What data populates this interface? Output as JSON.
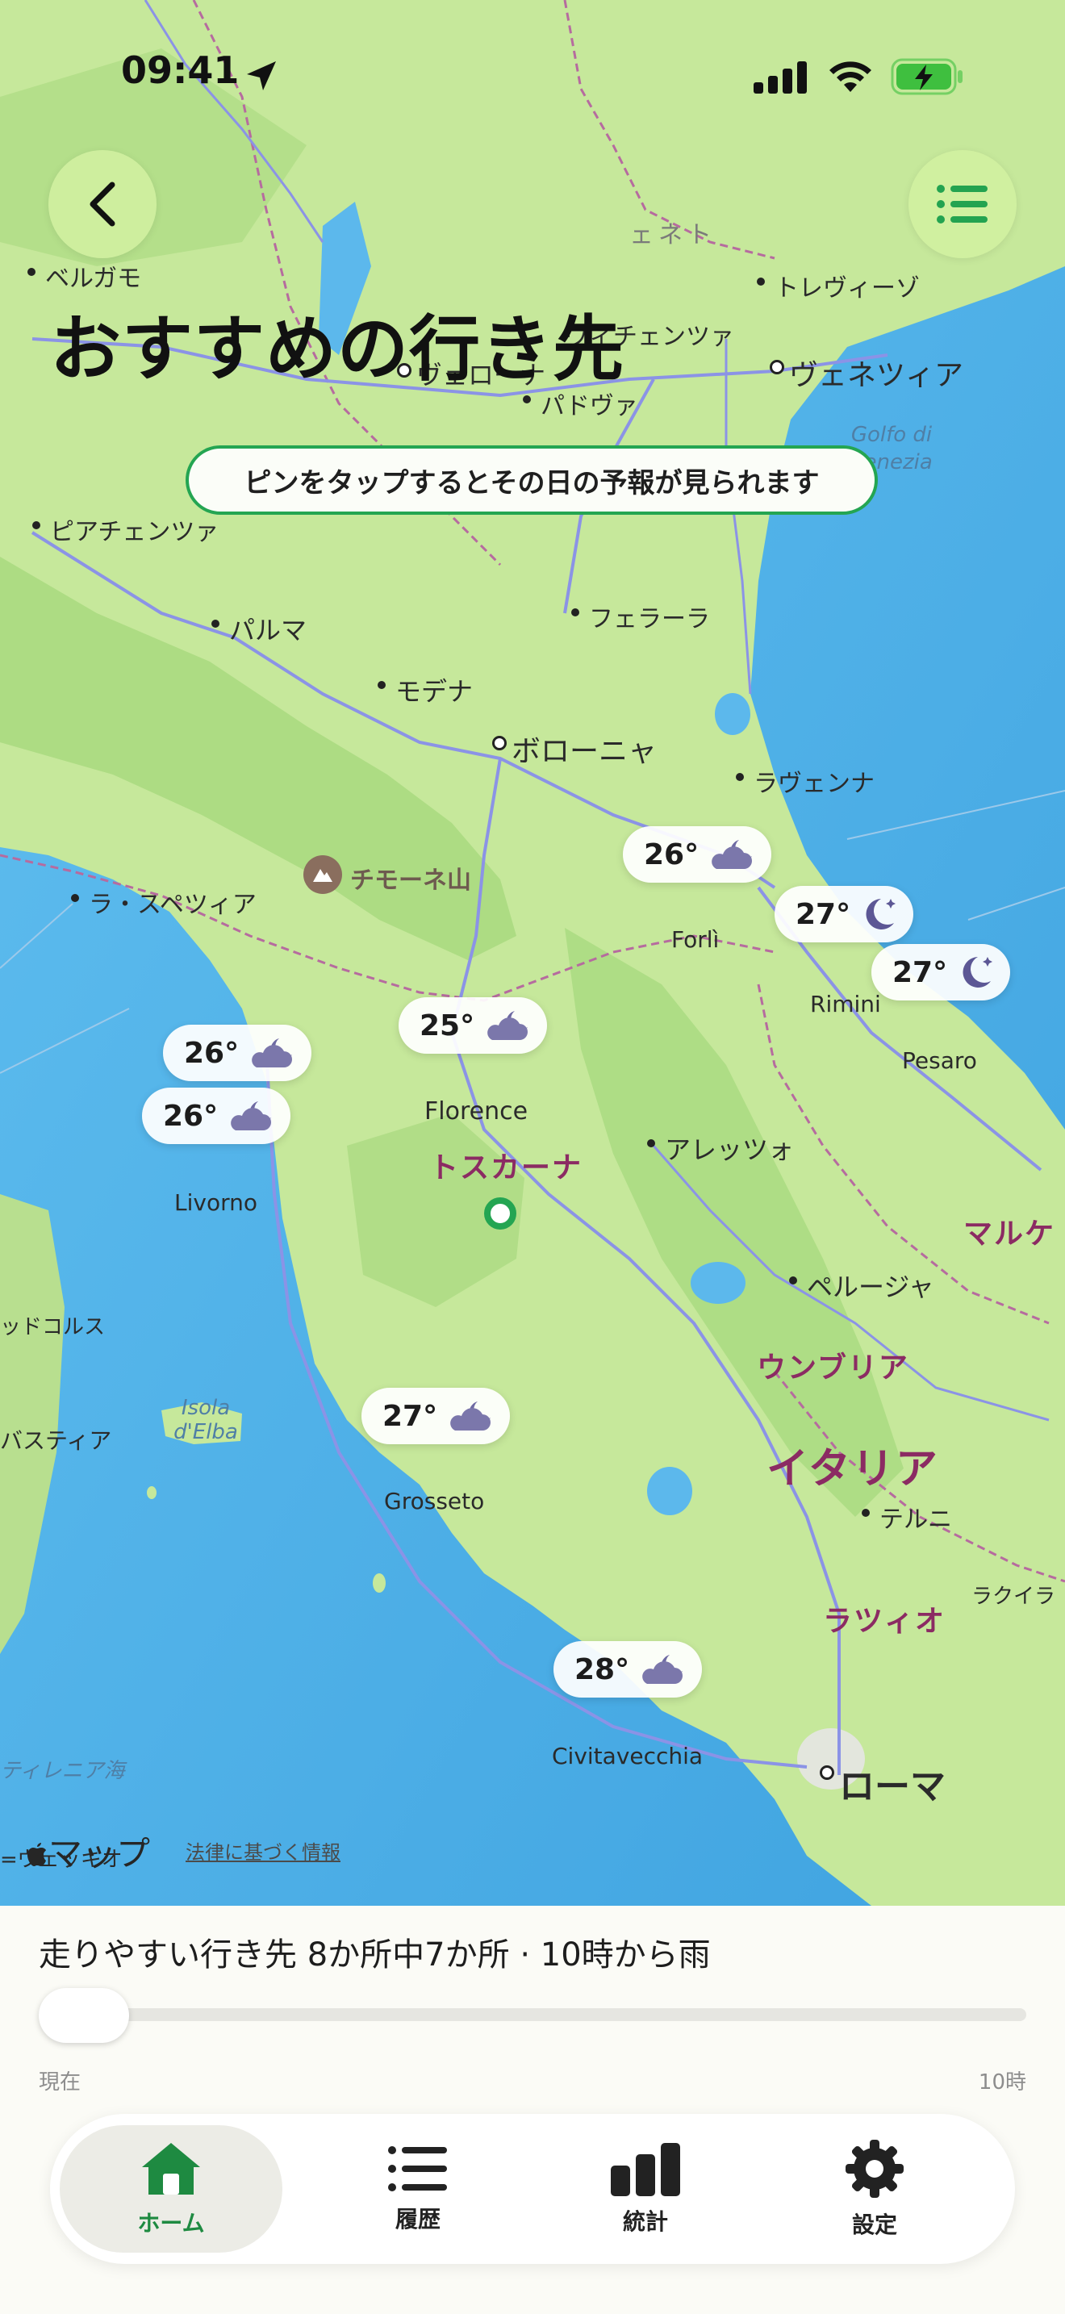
{
  "status_bar": {
    "time": "09:41",
    "location_icon": "location-arrow-icon",
    "signal_icon": "cellular-signal-icon",
    "wifi_icon": "wifi-icon",
    "battery_icon": "battery-charging-icon"
  },
  "header": {
    "back_icon": "chevron-left-icon",
    "list_icon": "list-icon",
    "title": "おすすめの行き先"
  },
  "hint": "ピンをタップするとその日の予報が見られます",
  "map": {
    "cities": [
      {
        "name": "ベルガモ"
      },
      {
        "name": "トレヴィーゾ"
      },
      {
        "name": "ヴィチェンツァ"
      },
      {
        "name": "ヴェローナ"
      },
      {
        "name": "パドヴァ"
      },
      {
        "name": "ヴェネツィア"
      },
      {
        "name": "ピアチェンツァ"
      },
      {
        "name": "パルマ"
      },
      {
        "name": "フェラーラ"
      },
      {
        "name": "モデナ"
      },
      {
        "name": "ボローニャ"
      },
      {
        "name": "ラヴェンナ"
      },
      {
        "name": "ラ・スペツィア"
      },
      {
        "name": "Forlì"
      },
      {
        "name": "Rimini"
      },
      {
        "name": "Pesaro"
      },
      {
        "name": "Florence"
      },
      {
        "name": "アレッツォ"
      },
      {
        "name": "Livorno"
      },
      {
        "name": "ペルージャ"
      },
      {
        "name": "Grosseto"
      },
      {
        "name": "テルニ"
      },
      {
        "name": "Civitavecchia"
      },
      {
        "name": "ローマ"
      },
      {
        "name": "ラクイラ"
      }
    ],
    "regions": [
      "トスカーナ",
      "ウンブリア",
      "マルケ",
      "イタリア",
      "ラツィオ"
    ],
    "sea": [
      "Golfo di Venezia",
      "Isola d'Elba",
      "ティレニア海"
    ],
    "peak": "チモーネ山",
    "partial_labels": [
      "ェネト",
      "ッドコルス",
      "バスティア",
      "=ヴェッキオ"
    ],
    "pins": [
      {
        "temp": "26°",
        "icon": "cloudy-night-icon"
      },
      {
        "temp": "27°",
        "icon": "moon-icon"
      },
      {
        "temp": "27°",
        "icon": "moon-icon"
      },
      {
        "temp": "25°",
        "icon": "cloudy-night-icon"
      },
      {
        "temp": "26°",
        "icon": "cloudy-night-icon"
      },
      {
        "temp": "26°",
        "icon": "cloudy-night-icon"
      },
      {
        "temp": "27°",
        "icon": "cloudy-night-icon"
      },
      {
        "temp": "28°",
        "icon": "cloudy-night-icon"
      }
    ],
    "attribution": "マップ",
    "legal_link": "法律に基づく情報"
  },
  "sheet": {
    "summary": "走りやすい行き先 8か所中7か所 · 10時から雨",
    "slider_position": 0,
    "start_label": "現在",
    "end_label": "10時"
  },
  "tabs": [
    {
      "label": "ホーム",
      "icon": "home-icon",
      "active": true
    },
    {
      "label": "履歴",
      "icon": "list-icon",
      "active": false
    },
    {
      "label": "統計",
      "icon": "bar-chart-icon",
      "active": false
    },
    {
      "label": "設定",
      "icon": "gear-icon",
      "active": false
    }
  ],
  "colors": {
    "accent": "#24a552",
    "land": "#c9ea9e",
    "sea": "#5cb8ec",
    "region_text": "#8b2b63"
  }
}
